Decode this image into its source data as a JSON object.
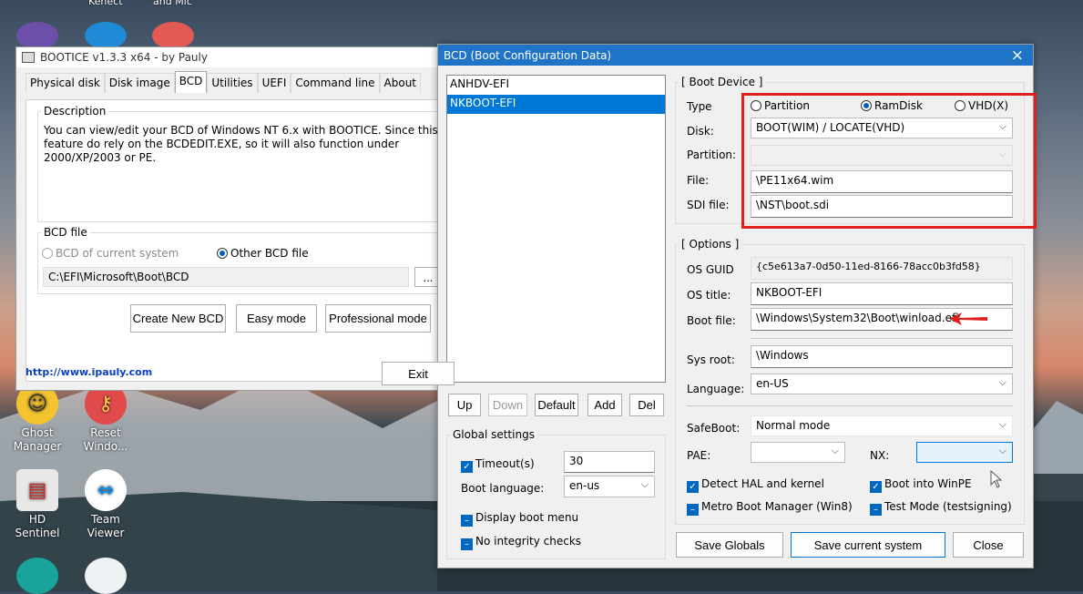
{
  "desktop": {
    "top_labels": [
      "Kenect",
      "and Mic"
    ],
    "icons": [
      {
        "label_lines": [
          "Ghost",
          "Manager"
        ]
      },
      {
        "label_lines": [
          "Reset",
          "Windo..."
        ]
      },
      {
        "label_lines": [
          "HD Sentinel"
        ]
      },
      {
        "label_lines": [
          "Team Viewer"
        ]
      }
    ]
  },
  "bootice": {
    "title": "BOOTICE v1.3.3 x64 - by Pauly",
    "tabs": [
      "Physical disk",
      "Disk image",
      "BCD",
      "Utilities",
      "UEFI",
      "Command line",
      "About"
    ],
    "description_title": "Description",
    "description_text": "You can view/edit your BCD of Windows NT 6.x with BOOTICE. Since this feature do rely on the BCDEDIT.EXE, so it will also function under 2000/XP/2003 or PE.",
    "bcd_file_title": "BCD file",
    "radio_current": "BCD of current system",
    "radio_other": "Other BCD file",
    "bcd_path": "C:\\EFI\\Microsoft\\Boot\\BCD",
    "browse_label": "...",
    "create_label": "Create New BCD",
    "easy_label": "Easy mode",
    "pro_label": "Professional mode",
    "link": "http://www.ipauly.com",
    "exit_label": "Exit"
  },
  "bcd": {
    "title": "BCD (Boot Configuration Data)",
    "close_icon": "×",
    "entries": [
      "ANHDV-EFI",
      "NKBOOT-EFI"
    ],
    "selected_entry": "NKBOOT-EFI",
    "buttons": {
      "up": "Up",
      "down": "Down",
      "default": "Default",
      "add": "Add",
      "del": "Del"
    },
    "global": {
      "title": "Global settings",
      "timeout_label": "Timeout(s)",
      "timeout_value": "30",
      "boot_language_label": "Boot language:",
      "boot_language_value": "en-us",
      "display_menu": "Display boot menu",
      "no_integrity": "No integrity checks"
    },
    "boot_device": {
      "title": "[ Boot Device ]",
      "type_label": "Type",
      "type_partition": "Partition",
      "type_ramdisk": "RamDisk",
      "type_vhd": "VHD(X)",
      "disk_label": "Disk:",
      "disk_value": "BOOT(WIM) / LOCATE(VHD)",
      "partition_label": "Partition:",
      "file_label": "File:",
      "file_value": "\\PE11x64.wim",
      "sdi_label": "SDI file:",
      "sdi_value": "\\NST\\boot.sdi"
    },
    "options": {
      "title": "[ Options ]",
      "guid_label": "OS GUID",
      "guid_value": "{c5e613a7-0d50-11ed-8166-78acc0b3fd58}",
      "ostitle_label": "OS title:",
      "ostitle_value": "NKBOOT-EFI",
      "bootfile_label": "Boot file:",
      "bootfile_value": "\\Windows\\System32\\Boot\\winload.efi",
      "sysroot_label": "Sys root:",
      "sysroot_value": "\\Windows",
      "language_label": "Language:",
      "language_value": "en-US",
      "safeboot_label": "SafeBoot:",
      "safeboot_value": "Normal mode",
      "pae_label": "PAE:",
      "nx_label": "NX:",
      "detect_hal": "Detect HAL and kernel",
      "boot_winpe": "Boot into WinPE",
      "metro": "Metro Boot Manager (Win8)",
      "testmode": "Test Mode (testsigning)"
    },
    "save_globals": "Save Globals",
    "save_current": "Save current system",
    "close": "Close"
  },
  "colors": {
    "highlight_box": "#e0201c",
    "selection": "#0078d7",
    "arrow": "#e0201c"
  }
}
